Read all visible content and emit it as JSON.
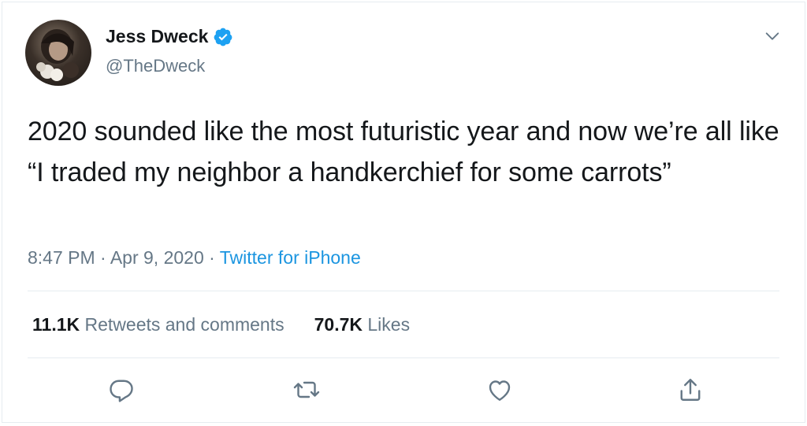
{
  "tweet": {
    "author": {
      "display_name": "Jess Dweck",
      "handle": "@TheDweck",
      "verified_icon": "verified-badge-icon"
    },
    "text": "2020 sounded like the most futuristic year and now we’re all like “I traded my neighbor a handkerchief for some carrots”",
    "time": "8:47 PM",
    "separator": " · ",
    "date": "Apr 9, 2020",
    "source": "Twitter for iPhone",
    "stats": {
      "retweets_count": "11.1K",
      "retweets_label": "Retweets and comments",
      "likes_count": "70.7K",
      "likes_label": "Likes"
    },
    "actions": [
      {
        "name": "reply-icon"
      },
      {
        "name": "retweet-icon"
      },
      {
        "name": "like-icon"
      },
      {
        "name": "share-icon"
      }
    ]
  },
  "colors": {
    "text": "#14171a",
    "muted": "#657786",
    "accent": "#1b95e0",
    "divider": "#e6ecf0"
  }
}
